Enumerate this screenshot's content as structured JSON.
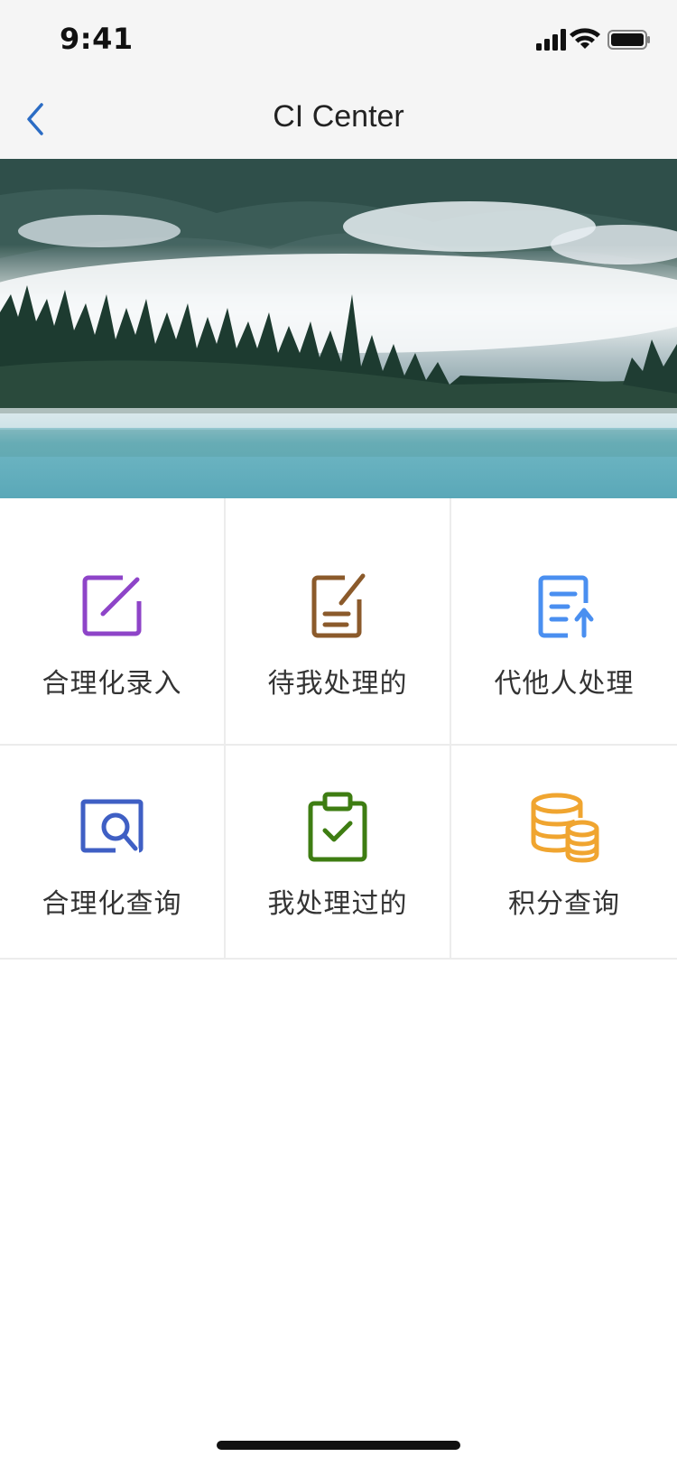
{
  "status_bar": {
    "time": "9:41"
  },
  "nav": {
    "title": "CI Center",
    "back_icon": "chevron-left-icon"
  },
  "banner": {
    "alt": "misty lake with forest"
  },
  "menu": [
    {
      "label": "合理化录入",
      "icon": "edit-square-icon",
      "color": "#8e44c8"
    },
    {
      "label": "待我处理的",
      "icon": "document-edit-icon",
      "color": "#8b5a2b"
    },
    {
      "label": "代他人处理",
      "icon": "document-upload-icon",
      "color": "#4a8ff0"
    },
    {
      "label": "合理化查询",
      "icon": "search-screen-icon",
      "color": "#3f5fc4"
    },
    {
      "label": "我处理过的",
      "icon": "clipboard-check-icon",
      "color": "#3e7d12"
    },
    {
      "label": "积分查询",
      "icon": "coins-icon",
      "color": "#f0a530"
    }
  ]
}
